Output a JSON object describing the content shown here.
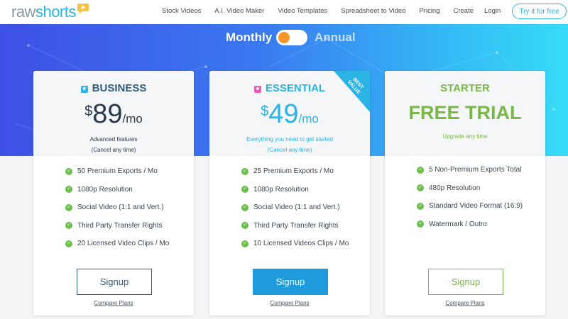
{
  "header": {
    "logo": {
      "part1": "raw",
      "part2": "shorts",
      "mark_icon": "play-bubble-icon"
    },
    "nav": [
      "Stock Videos",
      "A.I. Video Maker",
      "Video Templates",
      "Spreadsheet to Video",
      "Pricing",
      "Create"
    ],
    "login": "Login",
    "cta": "Try it for free"
  },
  "toggle": {
    "monthly": "Monthly",
    "annual": "Annual",
    "selected": "Monthly"
  },
  "plans": [
    {
      "name": "BUSINESS",
      "badge_color": "#2bb3e6",
      "currency": "$",
      "amount": "89",
      "period": "/mo",
      "subtitle_1": "Advanced features",
      "subtitle_2": "(Cancel any time)",
      "features": [
        "50 Premium Exports / Mo",
        "1080p Resolution",
        "Social Video (1:1 and Vert.)",
        "Third Party Transfer Rights",
        "20 Licensed Video Clips / Mo"
      ],
      "button": "Signup",
      "compare": "Compare Plans"
    },
    {
      "name": "ESSENTIAL",
      "badge_color": "#e55ab8",
      "currency": "$",
      "amount": "49",
      "period": "/mo",
      "subtitle_1": "Everything you need to get started",
      "subtitle_2": "(Cancel any time)",
      "ribbon": "BEST VALUE",
      "features": [
        "25 Premium Exports / Mo",
        "1080p Resolution",
        "Social Video (1:1 and Vert.)",
        "Third Party Transfer Rights",
        "10 Licensed Videos Clips / Mo"
      ],
      "button": "Signup",
      "compare": "Compare Plans"
    },
    {
      "name": "STARTER",
      "headline": "FREE TRIAL",
      "subtitle_1": "Upgrade any time",
      "features": [
        "5 Non-Premium Exports Total",
        "480p Resolution",
        "Standard Video Format (16:9)",
        "Watermark / Outro"
      ],
      "button": "Signup",
      "compare": "Compare Plans"
    }
  ],
  "colors": {
    "accent_blue": "#2bb3e6",
    "dark_blue": "#2f6fa0",
    "green": "#7ab648",
    "check_green": "#6cbf4a",
    "toggle_knob": "#f4962b"
  }
}
